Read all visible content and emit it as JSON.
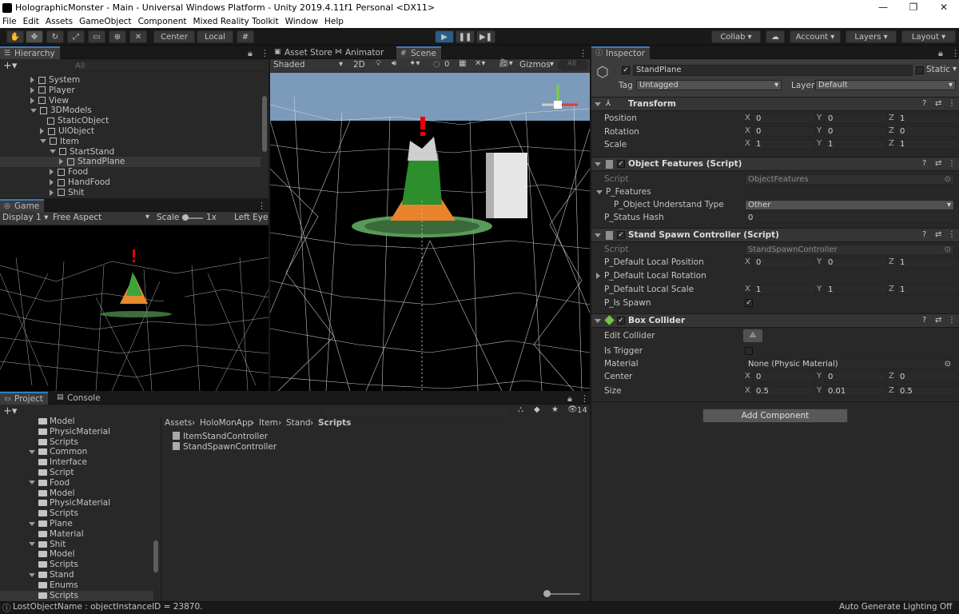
{
  "window": {
    "title": "HolographicMonster - Main - Universal Windows Platform - Unity 2019.4.11f1 Personal <DX11>",
    "minimize": "—",
    "maximize": "❐",
    "close": "✕"
  },
  "menu": [
    "File",
    "Edit",
    "Assets",
    "GameObject",
    "Component",
    "Mixed Reality Toolkit",
    "Window",
    "Help"
  ],
  "toolbar": {
    "center": "Center",
    "local": "Local",
    "collab": "Collab",
    "account": "Account",
    "layers": "Layers",
    "layout": "Layout"
  },
  "hierarchy": {
    "tab": "Hierarchy",
    "search_placeholder": "All",
    "items": [
      {
        "label": "System",
        "indent": 2,
        "expand": "right",
        "icon": "cube"
      },
      {
        "label": "Player",
        "indent": 2,
        "expand": "right",
        "icon": "cube"
      },
      {
        "label": "View",
        "indent": 2,
        "expand": "right",
        "icon": "cube"
      },
      {
        "label": "3DModels",
        "indent": 2,
        "expand": "down",
        "icon": "cube"
      },
      {
        "label": "StaticObject",
        "indent": 3,
        "expand": "none",
        "icon": "cube"
      },
      {
        "label": "UIObject",
        "indent": 3,
        "expand": "right",
        "icon": "cube"
      },
      {
        "label": "Item",
        "indent": 3,
        "expand": "down",
        "icon": "cube"
      },
      {
        "label": "StartStand",
        "indent": 4,
        "expand": "down",
        "icon": "cube"
      },
      {
        "label": "StandPlane",
        "indent": 5,
        "expand": "right",
        "icon": "cube",
        "selected": true
      },
      {
        "label": "Food",
        "indent": 4,
        "expand": "right",
        "icon": "cube"
      },
      {
        "label": "HandFood",
        "indent": 4,
        "expand": "right",
        "icon": "cube"
      },
      {
        "label": "Shit",
        "indent": 4,
        "expand": "right",
        "icon": "cube"
      }
    ]
  },
  "game": {
    "tab": "Game",
    "display": "Display 1",
    "aspect": "Free Aspect",
    "scale_label": "Scale",
    "scale_value": "1x",
    "eye": "Left Eye"
  },
  "scene": {
    "tabs": [
      "Asset Store",
      "Animator",
      "Scene"
    ],
    "shading": "Shaded",
    "mode2d": "2D",
    "hidden_count": "0",
    "gizmos": "Gizmos",
    "search_placeholder": "All"
  },
  "project": {
    "tabs": [
      "Project",
      "Console"
    ],
    "hidden_count": "14",
    "tree": [
      {
        "label": "Model",
        "indent": 3,
        "expand": "none"
      },
      {
        "label": "PhysicMaterial",
        "indent": 3,
        "expand": "none"
      },
      {
        "label": "Scripts",
        "indent": 3,
        "expand": "none"
      },
      {
        "label": "Common",
        "indent": 2,
        "expand": "down"
      },
      {
        "label": "Interface",
        "indent": 3,
        "expand": "none"
      },
      {
        "label": "Script",
        "indent": 3,
        "expand": "none"
      },
      {
        "label": "Food",
        "indent": 2,
        "expand": "down"
      },
      {
        "label": "Model",
        "indent": 3,
        "expand": "none"
      },
      {
        "label": "PhysicMaterial",
        "indent": 3,
        "expand": "none"
      },
      {
        "label": "Scripts",
        "indent": 3,
        "expand": "none"
      },
      {
        "label": "Plane",
        "indent": 2,
        "expand": "down"
      },
      {
        "label": "Material",
        "indent": 3,
        "expand": "none"
      },
      {
        "label": "Shit",
        "indent": 2,
        "expand": "down"
      },
      {
        "label": "Model",
        "indent": 3,
        "expand": "none"
      },
      {
        "label": "Scripts",
        "indent": 3,
        "expand": "none"
      },
      {
        "label": "Stand",
        "indent": 2,
        "expand": "down"
      },
      {
        "label": "Enums",
        "indent": 3,
        "expand": "none"
      },
      {
        "label": "Scripts",
        "indent": 3,
        "expand": "none",
        "selected": true
      }
    ],
    "breadcrumb": [
      "Assets",
      "HoloMonApp",
      "Item",
      "Stand",
      "Scripts"
    ],
    "files": [
      "ItemStandController",
      "StandSpawnController"
    ]
  },
  "inspector": {
    "tab": "Inspector",
    "object_name": "StandPlane",
    "static_label": "Static",
    "tag_label": "Tag",
    "tag_value": "Untagged",
    "layer_label": "Layer",
    "layer_value": "Default",
    "transform": {
      "title": "Transform",
      "position_label": "Position",
      "rotation_label": "Rotation",
      "scale_label": "Scale",
      "position": [
        "0",
        "0",
        "1"
      ],
      "rotation": [
        "0",
        "0",
        "0"
      ],
      "scale": [
        "1",
        "1",
        "1"
      ]
    },
    "object_features": {
      "title": "Object Features (Script)",
      "script_label": "Script",
      "script_value": "ObjectFeatures",
      "features_label": "P_Features",
      "understand_label": "P_Object Understand Type",
      "understand_value": "Other",
      "hash_label": "P_Status Hash",
      "hash_value": "0"
    },
    "stand_spawn": {
      "title": "Stand Spawn Controller (Script)",
      "script_label": "Script",
      "script_value": "StandSpawnController",
      "pos_label": "P_Default Local Position",
      "pos": [
        "0",
        "0",
        "1"
      ],
      "rot_label": "P_Default Local Rotation",
      "scale_label": "P_Default Local Scale",
      "scale": [
        "1",
        "1",
        "1"
      ],
      "spawn_label": "P_Is Spawn"
    },
    "box_collider": {
      "title": "Box Collider",
      "edit_label": "Edit Collider",
      "trigger_label": "Is Trigger",
      "material_label": "Material",
      "material_value": "None (Physic Material)",
      "center_label": "Center",
      "center": [
        "0",
        "0",
        "0"
      ],
      "size_label": "Size",
      "size": [
        "0.5",
        "0.01",
        "0.5"
      ]
    },
    "add_component": "Add Component"
  },
  "axes": {
    "x": "X",
    "y": "Y",
    "z": "Z"
  },
  "status": {
    "message": "LostObjectName : objectInstanceID = 23870.",
    "lighting": "Auto Generate Lighting Off"
  },
  "colors": {
    "accent": "#3a79bb",
    "selection": "#2c5d87",
    "panel": "#282828",
    "header": "#191919"
  }
}
